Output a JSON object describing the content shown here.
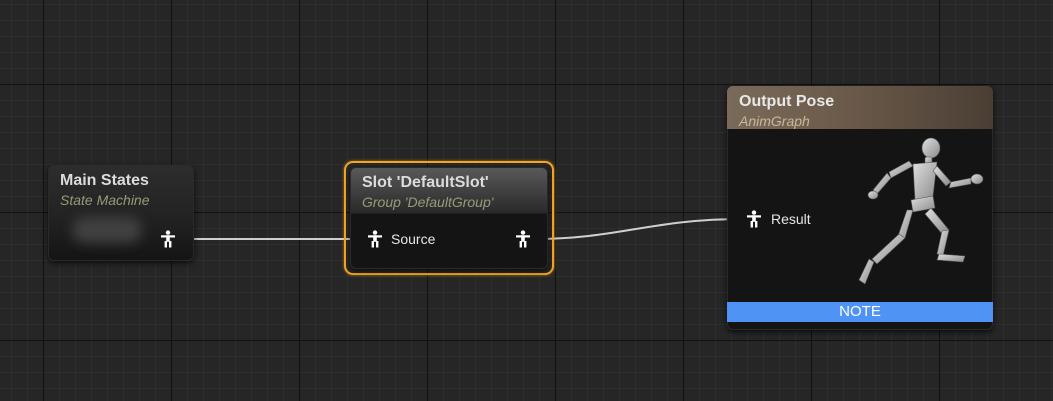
{
  "nodes": {
    "main_states": {
      "title": "Main States",
      "subtitle": "State Machine"
    },
    "slot": {
      "title": "Slot 'DefaultSlot'",
      "subtitle": "Group 'DefaultGroup'",
      "input_pin_label": "Source"
    },
    "output_pose": {
      "title": "Output Pose",
      "subtitle": "AnimGraph",
      "input_pin_label": "Result",
      "note_label": "NOTE"
    }
  },
  "colors": {
    "selection_outline": "#f5a623",
    "note_bar": "#4f94f5",
    "output_header": "#7a6a5a",
    "wire": "#d0d0d0"
  },
  "icons": {
    "pose_pin": "pose-pin-icon",
    "preview": "mannequin-preview-icon"
  }
}
